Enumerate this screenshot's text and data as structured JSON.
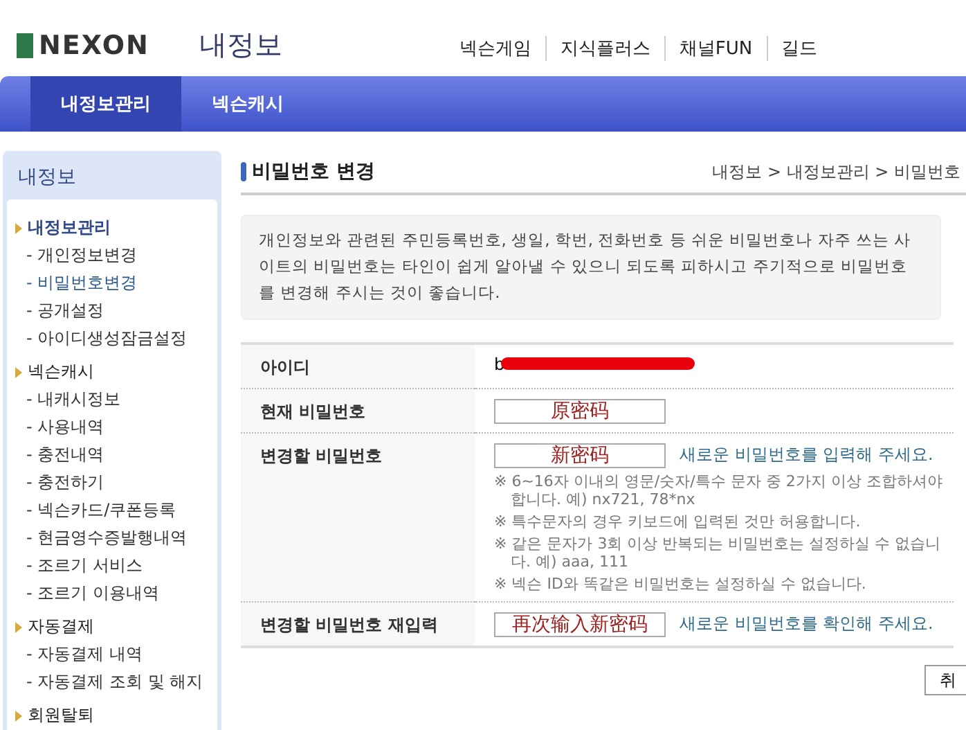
{
  "header": {
    "logo": "NEXON",
    "title": "내정보",
    "nav": [
      "넥슨게임",
      "지식플러스",
      "채널FUN",
      "길드"
    ]
  },
  "tabs": [
    {
      "label": "내정보관리",
      "selected": true
    },
    {
      "label": "넥슨캐시",
      "selected": false
    }
  ],
  "sidebar": {
    "title": "내정보",
    "groups": [
      {
        "label": "내정보관리",
        "selected": true,
        "items": [
          {
            "label": "- 개인정보변경",
            "selected": false
          },
          {
            "label": "- 비밀번호변경",
            "selected": true
          },
          {
            "label": "- 공개설정",
            "selected": false
          },
          {
            "label": "- 아이디생성잠금설정",
            "selected": false
          }
        ]
      },
      {
        "label": "넥슨캐시",
        "selected": false,
        "items": [
          {
            "label": "- 내캐시정보",
            "selected": false
          },
          {
            "label": "- 사용내역",
            "selected": false
          },
          {
            "label": "- 충전내역",
            "selected": false
          },
          {
            "label": "- 충전하기",
            "selected": false
          },
          {
            "label": "- 넥슨카드/쿠폰등록",
            "selected": false
          },
          {
            "label": "- 현금영수증발행내역",
            "selected": false
          },
          {
            "label": "- 조르기 서비스",
            "selected": false
          },
          {
            "label": "- 조르기 이용내역",
            "selected": false
          }
        ]
      },
      {
        "label": "자동결제",
        "selected": false,
        "items": [
          {
            "label": "- 자동결제 내역",
            "selected": false
          },
          {
            "label": "- 자동결제 조회 및 해지",
            "selected": false
          }
        ]
      },
      {
        "label": "회원탈퇴",
        "selected": false
      }
    ]
  },
  "page": {
    "title": "비밀번호 변경",
    "breadcrumb": "내정보 > 내정보관리 > 비밀번호",
    "notice": "개인정보와 관련된 주민등록번호, 생일, 학번, 전화번호 등 쉬운 비밀번호나 자주 쓰는 사이트의 비밀번호는 타인이 쉽게 알아낼 수 있으니 되도록 피하시고 주기적으로 비밀번호를 변경해 주시는 것이 좋습니다.",
    "rows": [
      {
        "kind": "text",
        "label": "아이디",
        "value": "b",
        "redacted": true
      },
      {
        "kind": "field",
        "label": "현재 비밀번호",
        "value": "原密码"
      },
      {
        "kind": "field",
        "label": "변경할 비밀번호",
        "value": "新密码",
        "hint": "새로운 비밀번호를 입력해 주세요.",
        "notes": [
          "※ 6~16자 이내의 영문/숫자/특수 문자 중 2가지 이상 조합하셔야 합니다. 예) nx721, 78*nx",
          "※ 특수문자의 경우 키보드에 입력된 것만 허용합니다.",
          "※ 같은 문자가 3회 이상 반복되는 비밀번호는 설정하실 수 없습니다. 예) aaa, 111",
          "※ 넥슨 ID와 똑같은 비밀번호는 설정하실 수 없습니다."
        ]
      },
      {
        "kind": "field",
        "label": "변경할 비밀번호 재입력",
        "value": "再次输入新密码",
        "hint": "새로운 비밀번호를 확인해 주세요."
      }
    ],
    "buttons": [
      "취"
    ]
  }
}
